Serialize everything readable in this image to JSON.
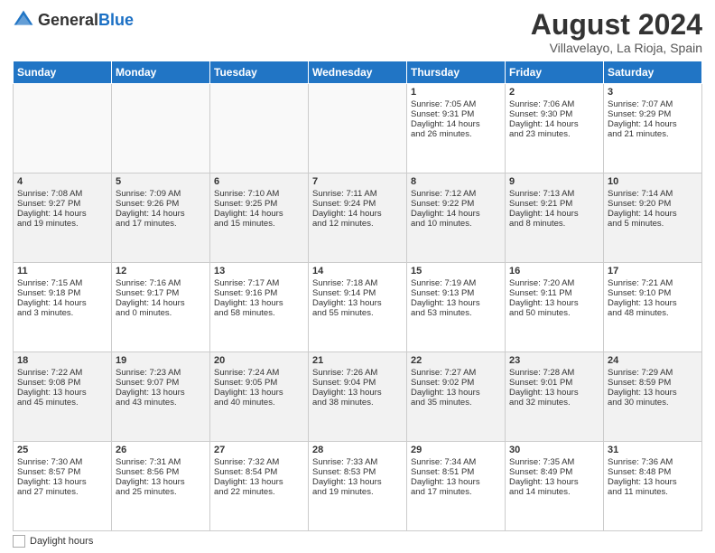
{
  "header": {
    "logo_general": "General",
    "logo_blue": "Blue",
    "main_title": "August 2024",
    "subtitle": "Villavelayo, La Rioja, Spain"
  },
  "weekdays": [
    "Sunday",
    "Monday",
    "Tuesday",
    "Wednesday",
    "Thursday",
    "Friday",
    "Saturday"
  ],
  "weeks": [
    [
      {
        "day": "",
        "lines": []
      },
      {
        "day": "",
        "lines": []
      },
      {
        "day": "",
        "lines": []
      },
      {
        "day": "",
        "lines": []
      },
      {
        "day": "1",
        "lines": [
          "Sunrise: 7:05 AM",
          "Sunset: 9:31 PM",
          "Daylight: 14 hours",
          "and 26 minutes."
        ]
      },
      {
        "day": "2",
        "lines": [
          "Sunrise: 7:06 AM",
          "Sunset: 9:30 PM",
          "Daylight: 14 hours",
          "and 23 minutes."
        ]
      },
      {
        "day": "3",
        "lines": [
          "Sunrise: 7:07 AM",
          "Sunset: 9:29 PM",
          "Daylight: 14 hours",
          "and 21 minutes."
        ]
      }
    ],
    [
      {
        "day": "4",
        "lines": [
          "Sunrise: 7:08 AM",
          "Sunset: 9:27 PM",
          "Daylight: 14 hours",
          "and 19 minutes."
        ]
      },
      {
        "day": "5",
        "lines": [
          "Sunrise: 7:09 AM",
          "Sunset: 9:26 PM",
          "Daylight: 14 hours",
          "and 17 minutes."
        ]
      },
      {
        "day": "6",
        "lines": [
          "Sunrise: 7:10 AM",
          "Sunset: 9:25 PM",
          "Daylight: 14 hours",
          "and 15 minutes."
        ]
      },
      {
        "day": "7",
        "lines": [
          "Sunrise: 7:11 AM",
          "Sunset: 9:24 PM",
          "Daylight: 14 hours",
          "and 12 minutes."
        ]
      },
      {
        "day": "8",
        "lines": [
          "Sunrise: 7:12 AM",
          "Sunset: 9:22 PM",
          "Daylight: 14 hours",
          "and 10 minutes."
        ]
      },
      {
        "day": "9",
        "lines": [
          "Sunrise: 7:13 AM",
          "Sunset: 9:21 PM",
          "Daylight: 14 hours",
          "and 8 minutes."
        ]
      },
      {
        "day": "10",
        "lines": [
          "Sunrise: 7:14 AM",
          "Sunset: 9:20 PM",
          "Daylight: 14 hours",
          "and 5 minutes."
        ]
      }
    ],
    [
      {
        "day": "11",
        "lines": [
          "Sunrise: 7:15 AM",
          "Sunset: 9:18 PM",
          "Daylight: 14 hours",
          "and 3 minutes."
        ]
      },
      {
        "day": "12",
        "lines": [
          "Sunrise: 7:16 AM",
          "Sunset: 9:17 PM",
          "Daylight: 14 hours",
          "and 0 minutes."
        ]
      },
      {
        "day": "13",
        "lines": [
          "Sunrise: 7:17 AM",
          "Sunset: 9:16 PM",
          "Daylight: 13 hours",
          "and 58 minutes."
        ]
      },
      {
        "day": "14",
        "lines": [
          "Sunrise: 7:18 AM",
          "Sunset: 9:14 PM",
          "Daylight: 13 hours",
          "and 55 minutes."
        ]
      },
      {
        "day": "15",
        "lines": [
          "Sunrise: 7:19 AM",
          "Sunset: 9:13 PM",
          "Daylight: 13 hours",
          "and 53 minutes."
        ]
      },
      {
        "day": "16",
        "lines": [
          "Sunrise: 7:20 AM",
          "Sunset: 9:11 PM",
          "Daylight: 13 hours",
          "and 50 minutes."
        ]
      },
      {
        "day": "17",
        "lines": [
          "Sunrise: 7:21 AM",
          "Sunset: 9:10 PM",
          "Daylight: 13 hours",
          "and 48 minutes."
        ]
      }
    ],
    [
      {
        "day": "18",
        "lines": [
          "Sunrise: 7:22 AM",
          "Sunset: 9:08 PM",
          "Daylight: 13 hours",
          "and 45 minutes."
        ]
      },
      {
        "day": "19",
        "lines": [
          "Sunrise: 7:23 AM",
          "Sunset: 9:07 PM",
          "Daylight: 13 hours",
          "and 43 minutes."
        ]
      },
      {
        "day": "20",
        "lines": [
          "Sunrise: 7:24 AM",
          "Sunset: 9:05 PM",
          "Daylight: 13 hours",
          "and 40 minutes."
        ]
      },
      {
        "day": "21",
        "lines": [
          "Sunrise: 7:26 AM",
          "Sunset: 9:04 PM",
          "Daylight: 13 hours",
          "and 38 minutes."
        ]
      },
      {
        "day": "22",
        "lines": [
          "Sunrise: 7:27 AM",
          "Sunset: 9:02 PM",
          "Daylight: 13 hours",
          "and 35 minutes."
        ]
      },
      {
        "day": "23",
        "lines": [
          "Sunrise: 7:28 AM",
          "Sunset: 9:01 PM",
          "Daylight: 13 hours",
          "and 32 minutes."
        ]
      },
      {
        "day": "24",
        "lines": [
          "Sunrise: 7:29 AM",
          "Sunset: 8:59 PM",
          "Daylight: 13 hours",
          "and 30 minutes."
        ]
      }
    ],
    [
      {
        "day": "25",
        "lines": [
          "Sunrise: 7:30 AM",
          "Sunset: 8:57 PM",
          "Daylight: 13 hours",
          "and 27 minutes."
        ]
      },
      {
        "day": "26",
        "lines": [
          "Sunrise: 7:31 AM",
          "Sunset: 8:56 PM",
          "Daylight: 13 hours",
          "and 25 minutes."
        ]
      },
      {
        "day": "27",
        "lines": [
          "Sunrise: 7:32 AM",
          "Sunset: 8:54 PM",
          "Daylight: 13 hours",
          "and 22 minutes."
        ]
      },
      {
        "day": "28",
        "lines": [
          "Sunrise: 7:33 AM",
          "Sunset: 8:53 PM",
          "Daylight: 13 hours",
          "and 19 minutes."
        ]
      },
      {
        "day": "29",
        "lines": [
          "Sunrise: 7:34 AM",
          "Sunset: 8:51 PM",
          "Daylight: 13 hours",
          "and 17 minutes."
        ]
      },
      {
        "day": "30",
        "lines": [
          "Sunrise: 7:35 AM",
          "Sunset: 8:49 PM",
          "Daylight: 13 hours",
          "and 14 minutes."
        ]
      },
      {
        "day": "31",
        "lines": [
          "Sunrise: 7:36 AM",
          "Sunset: 8:48 PM",
          "Daylight: 13 hours",
          "and 11 minutes."
        ]
      }
    ]
  ],
  "footer": {
    "daylight_label": "Daylight hours"
  }
}
